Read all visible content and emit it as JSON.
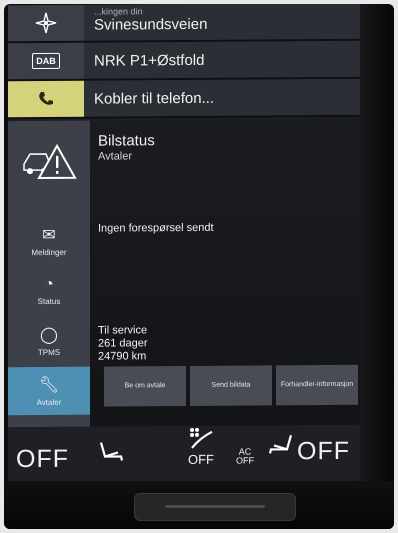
{
  "tiles": {
    "nav": {
      "sub": "...kingen din",
      "title": "Svinesundsveien"
    },
    "radio": {
      "icon_label": "DAB",
      "title": "NRK P1+Østfold"
    },
    "phone": {
      "title": "Kobler til telefon..."
    }
  },
  "sidebar": {
    "items": [
      {
        "label": "Meldinger",
        "icon": "message-icon"
      },
      {
        "label": "Status",
        "icon": "gauge-icon"
      },
      {
        "label": "TPMS",
        "icon": "tire-icon"
      },
      {
        "label": "Avtaler",
        "icon": "wrench-icon"
      }
    ]
  },
  "card": {
    "title": "Bilstatus",
    "subtitle": "Avtaler",
    "message": "Ingen forespørsel sendt",
    "service": {
      "label": "Til service",
      "days": "261 dager",
      "km": "24790 km"
    },
    "buttons": {
      "request": "Be om avtale",
      "send": "Send bildata",
      "dealer": "Forhandler-informasjon"
    }
  },
  "climate": {
    "left_temp": "OFF",
    "right_temp": "OFF",
    "fan_level": "OFF",
    "ac": "AC",
    "ac_state": "OFF"
  }
}
